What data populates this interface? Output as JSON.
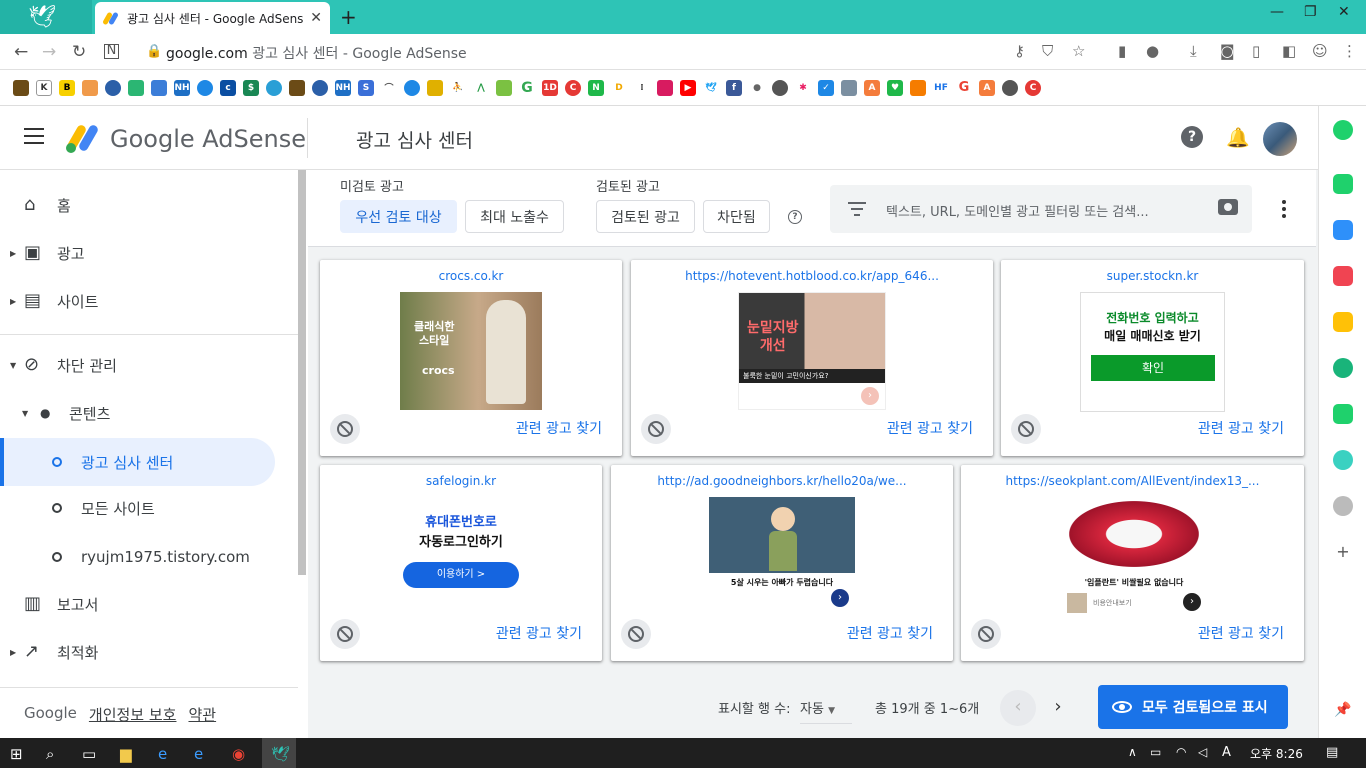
{
  "browser": {
    "tab_title": "광고 심사 센터 - Google AdSense",
    "tab_close": "✕",
    "new_tab": "+",
    "url_host": "google.com",
    "url_title": " 광고 심사 센터 - Google AdSense"
  },
  "header": {
    "brand": "Google AdSense",
    "page_title": "광고 심사 센터",
    "help": "?"
  },
  "sidebar": {
    "items": [
      {
        "label": "홈"
      },
      {
        "label": "광고"
      },
      {
        "label": "사이트"
      },
      {
        "label": "차단 관리"
      },
      {
        "label": "콘텐츠"
      },
      {
        "label": "광고 심사 센터"
      },
      {
        "label": "모든 사이트"
      },
      {
        "label": "ryujm1975.tistory.com"
      },
      {
        "label": "보고서"
      },
      {
        "label": "최적화"
      }
    ],
    "footer": {
      "google": "Google",
      "privacy": "개인정보 보호",
      "terms": "약관"
    }
  },
  "filters": {
    "unreviewed_label": "미검토 광고",
    "reviewed_label": "검토된 광고",
    "chips": [
      "우선 검토 대상",
      "최대 노출수",
      "검토된 광고",
      "차단됨"
    ],
    "help": "?",
    "search_placeholder": "텍스트, URL, 도메인별 광고 필터링 또는 검색..."
  },
  "cards": [
    {
      "domain": "crocs.co.kr",
      "related": "관련 광고 찾기",
      "ad_lines": [
        "클래식한",
        "스타일",
        "crocs"
      ]
    },
    {
      "domain": "https://hotevent.hotblood.co.kr/app_646...",
      "related": "관련 광고 찾기",
      "ad_lines": [
        "눈밑지방",
        "개선",
        "불룩한 눈밑이 고민이신가요?"
      ]
    },
    {
      "domain": "super.stockn.kr",
      "related": "관련 광고 찾기",
      "ad_lines": [
        "전화번호 입력하고",
        "매일 매매신호 받기",
        "확인"
      ]
    },
    {
      "domain": "safelogin.kr",
      "related": "관련 광고 찾기",
      "ad_lines": [
        "휴대폰번호로",
        "자동로그인하기",
        "이용하기 >"
      ]
    },
    {
      "domain": "http://ad.goodneighbors.kr/hello20a/we...",
      "related": "관련 광고 찾기",
      "ad_lines": [
        "5살 시우는 아빠가 두렵습니다"
      ]
    },
    {
      "domain": "https://seokplant.com/AllEvent/index13_...",
      "related": "관련 광고 찾기",
      "ad_lines": [
        "'임플란트' 비쌀필요 없습니다",
        "비용안내보기"
      ]
    }
  ],
  "pagination": {
    "rows_label": "표시할 행 수:",
    "rows_value": "자동",
    "range": "총 19개 중 1~6개",
    "prev": "‹",
    "next": "›",
    "mark_all": "모두 검토됨으로 표시"
  },
  "taskbar": {
    "time": "오후 8:26",
    "ime": "A"
  },
  "colors": {
    "accent": "#1a73e8",
    "teal": "#2ec4b6",
    "selected_bg": "#e8f0fe"
  }
}
